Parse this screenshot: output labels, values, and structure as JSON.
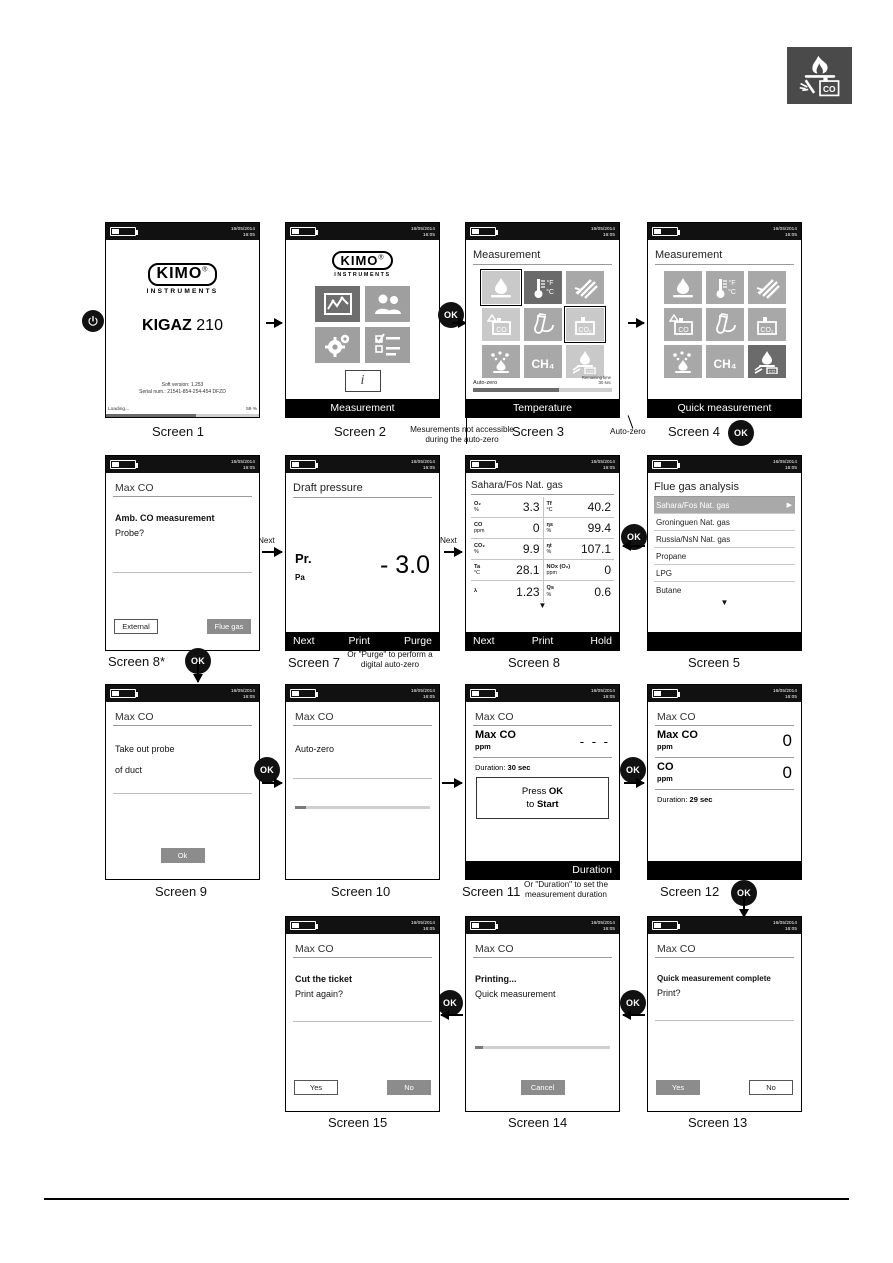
{
  "badge": {
    "name": "flue-gas-co-badge",
    "alt": "flue gas + draft + CO boiler icon"
  },
  "device": {
    "date": "16/05/2014",
    "time": "16:05"
  },
  "screens": {
    "s1": {
      "caption": "Screen 1",
      "logo_text": "KIMO",
      "logo_reg": "®",
      "logo_sub": "INSTRUMENTS",
      "model_bold": "KIGAZ",
      "model_light": "210",
      "soft_version": "Soft version: 1.253",
      "serial": "Serial num.: 21541-854-254-454 DFZD",
      "loading_label": "Loading...",
      "loading_pct": "59 %",
      "progress": 59
    },
    "s2": {
      "caption": "Screen 2",
      "logo_text": "KIMO",
      "logo_reg": "®",
      "logo_sub": "INSTRUMENTS",
      "tiles": [
        {
          "name": "measurement-tile",
          "icon": "chart-icon"
        },
        {
          "name": "users-tile",
          "icon": "users-icon"
        },
        {
          "name": "settings-tile",
          "icon": "gears-icon"
        },
        {
          "name": "checklist-tile",
          "icon": "checklist-icon"
        }
      ],
      "info_label": "i",
      "softkey": "Measurement"
    },
    "s3": {
      "caption": "Screen 3",
      "title": "Measurement",
      "cells": [
        {
          "name": "flue-gas-analysis-cell",
          "icon": "flame-icon"
        },
        {
          "name": "temperature-cell",
          "icon": "thermometer-icon"
        },
        {
          "name": "draft-pressure-cell",
          "icon": "draft-icon"
        },
        {
          "name": "ambient-co-cell",
          "icon": "co-alarm-icon"
        },
        {
          "name": "opacity-cell",
          "icon": "pump-icon"
        },
        {
          "name": "ambient-co2-cell",
          "icon": "co2-icon"
        },
        {
          "name": "gas-leak-cell",
          "icon": "gas-leak-icon"
        },
        {
          "name": "methane-cell",
          "icon": "ch4-icon"
        },
        {
          "name": "quick-measurement-cell",
          "icon": "quick-measure-icon"
        }
      ],
      "autozero_label": "Auto-zero",
      "autozero_progress": 62,
      "remaining_label": "Remaining time",
      "remaining_value": "30 sec",
      "softkey": "Temperature"
    },
    "s4": {
      "caption": "Screen 4",
      "title": "Measurement",
      "softkey": "Quick measurement"
    },
    "s5": {
      "caption": "Screen 5",
      "title": "Flue gas analysis",
      "items": [
        "Sahara/Fos Nat. gas",
        "Groninguen Nat. gas",
        "Russia/NsN Nat. gas",
        "Propane",
        "LPG",
        "Butane"
      ],
      "selected_index": 0,
      "chevron": "▶",
      "more": "▼"
    },
    "s7": {
      "caption": "Screen 7",
      "title": "Draft pressure",
      "label": "Pr.",
      "unit": "Pa",
      "value": "- 3.0",
      "softkeys": [
        "Next",
        "Print",
        "Purge"
      ],
      "note": "Or \"Purge\" to perform a digital auto-zero"
    },
    "s8": {
      "caption": "Screen 8",
      "title": "Sahara/Fos Nat. gas",
      "rows": [
        {
          "l_label": "O₂",
          "l_unit": "%",
          "l_value": "3.3",
          "r_label": "Tf",
          "r_unit": "°C",
          "r_value": "40.2"
        },
        {
          "l_label": "CO",
          "l_unit": "ppm",
          "l_value": "0",
          "r_label": "ηs",
          "r_unit": "%",
          "r_value": "99.4"
        },
        {
          "l_label": "CO₂",
          "l_unit": "%",
          "l_value": "9.9",
          "r_label": "ηt",
          "r_unit": "%",
          "r_value": "107.1"
        },
        {
          "l_label": "Ta",
          "l_unit": "°C",
          "l_value": "28.1",
          "r_label": "NOx (O₂)",
          "r_unit": "ppm",
          "r_value": "0"
        },
        {
          "l_label": "λ",
          "l_unit": "",
          "l_value": "1.23",
          "r_label": "Qs",
          "r_unit": "%",
          "r_value": "0.6"
        }
      ],
      "more": "▼",
      "softkeys": [
        "Next",
        "Print",
        "Hold"
      ]
    },
    "s8star": {
      "caption": "Screen 8*",
      "title": "Max CO",
      "headline": "Amb. CO measurement",
      "question": "Probe?",
      "buttons": [
        "External",
        "Flue gas"
      ]
    },
    "s9": {
      "caption": "Screen 9",
      "title": "Max CO",
      "line1": "Take out probe",
      "line2": "of duct",
      "button": "Ok"
    },
    "s10": {
      "caption": "Screen 10",
      "title": "Max CO",
      "text": "Auto-zero",
      "progress": 8
    },
    "s11": {
      "caption": "Screen 11",
      "title": "Max CO",
      "metric_label": "Max CO",
      "metric_unit": "ppm",
      "metric_value": "- - -",
      "duration_label": "Duration:",
      "duration_value": "30 sec",
      "press_line1": "Press",
      "press_ok": "OK",
      "press_line2": "to",
      "press_start": "Start",
      "softkey": "Duration",
      "note": "Or \"Duration\" to set the measurement duration"
    },
    "s12": {
      "caption": "Screen 12",
      "title": "Max CO",
      "metrics": [
        {
          "label": "Max CO",
          "unit": "ppm",
          "value": "0"
        },
        {
          "label": "CO",
          "unit": "ppm",
          "value": "0"
        }
      ],
      "duration_label": "Duration:",
      "duration_value": "29 sec"
    },
    "s13": {
      "caption": "Screen 13",
      "title": "Max CO",
      "headline": "Quick measurement complete",
      "question": "Print?",
      "buttons": [
        "Yes",
        "No"
      ]
    },
    "s14": {
      "caption": "Screen 14",
      "title": "Max CO",
      "headline": "Printing...",
      "text": "Quick measurement",
      "progress": 6,
      "button": "Cancel"
    },
    "s15": {
      "caption": "Screen 15",
      "title": "Max CO",
      "headline": "Cut the ticket",
      "question": "Print again?",
      "buttons": [
        "Yes",
        "No"
      ]
    }
  },
  "annotations": {
    "ok": "OK",
    "next": "Next",
    "autozero": "Auto-zero",
    "not_accessible_1": "Mesurements not accessible",
    "not_accessible_2": "during the auto-zero"
  }
}
